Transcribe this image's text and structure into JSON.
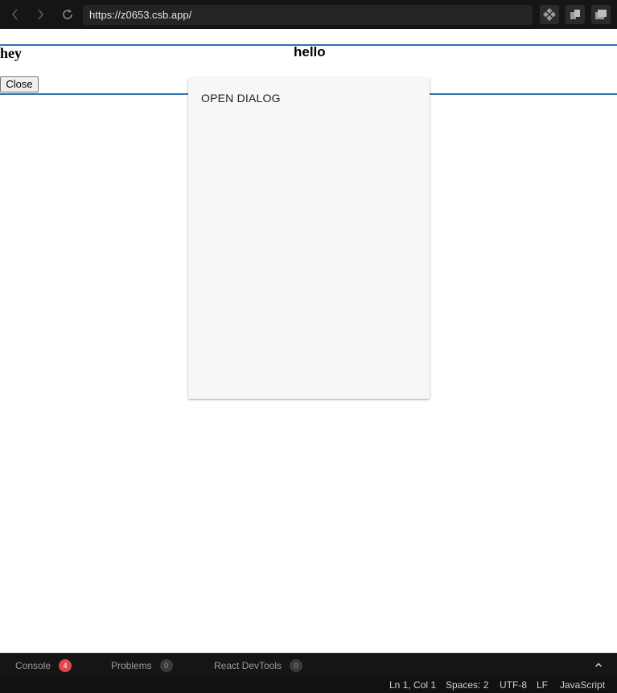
{
  "browser": {
    "url": "https://z0653.csb.app/",
    "back_icon": "chevron-left-icon",
    "forward_icon": "chevron-right-icon",
    "reload_icon": "reload-icon",
    "tools": [
      "extensions-icon",
      "copy-icon",
      "window-icon"
    ]
  },
  "page": {
    "appbar_border_color": "#2f6fb5",
    "heading_left": "hey",
    "heading_center": "hello",
    "close_button_label": "Close",
    "drawer": {
      "item_label": "OPEN DIALOG",
      "background": "#f7f7f7"
    }
  },
  "devtools": {
    "tabs": [
      {
        "label": "Console",
        "count": "4",
        "badge_color": "#e0474e"
      },
      {
        "label": "Problems",
        "count": "0",
        "badge_color": "#3b3b3b"
      },
      {
        "label": "React DevTools",
        "count": "0",
        "badge_color": "#3b3b3b"
      }
    ],
    "collapse_icon": "chevron-up-icon"
  },
  "statusbar": {
    "position": "Ln 1, Col 1",
    "spaces": "Spaces: 2",
    "encoding": "UTF-8",
    "line_ending": "LF",
    "language": "JavaScript"
  }
}
